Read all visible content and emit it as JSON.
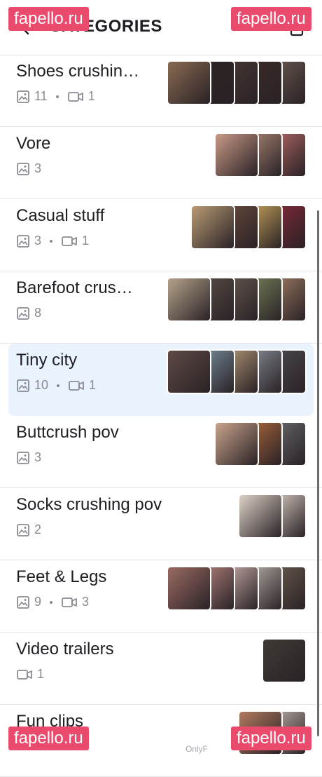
{
  "header": {
    "title": "CATEGORIES"
  },
  "rows": [
    {
      "title": "Shoes crushin…",
      "photos": "11",
      "videos": "1",
      "thumbs": [
        "#8a6a52",
        "#2e2424",
        "#4a3a36",
        "#3c2c28",
        "#6e5e52"
      ]
    },
    {
      "title": "Vore",
      "photos": "3",
      "videos": "",
      "thumbs": [
        "#c89a86",
        "#b68e7a",
        "#bd6e6a"
      ]
    },
    {
      "title": "Casual stuff",
      "photos": "3",
      "videos": "1",
      "thumbs": [
        "#b99b74",
        "#6e4e3e",
        "#d6b060",
        "#8e2a3a"
      ]
    },
    {
      "title": "Barefoot crus…",
      "photos": "8",
      "videos": "",
      "thumbs": [
        "#b4a28a",
        "#5c5248",
        "#6a5e52",
        "#7e8a5e",
        "#a8846a"
      ]
    },
    {
      "title": "Tiny city",
      "photos": "10",
      "videos": "1",
      "thumbs": [
        "#5e4a44",
        "#7e98a8",
        "#c0a27e",
        "#8e96a0",
        "#4e4e52"
      ]
    },
    {
      "title": "Buttcrush pov",
      "photos": "3",
      "videos": "",
      "thumbs": [
        "#c9a48c",
        "#b86e3e",
        "#6e7072"
      ]
    },
    {
      "title": "Socks crushing pov",
      "photos": "2",
      "videos": "",
      "thumbs": [
        "#dcd2c6",
        "#e8dcd0"
      ]
    },
    {
      "title": "Feet & Legs",
      "photos": "9",
      "videos": "3",
      "thumbs": [
        "#9a6a62",
        "#c08a86",
        "#d6b8b2",
        "#c4bcb4",
        "#6e6252"
      ]
    },
    {
      "title": "Video trailers",
      "photos": "",
      "videos": "1",
      "thumbs": [
        "#3e3a34"
      ]
    },
    {
      "title": "Fun clips",
      "photos": "",
      "videos": "",
      "thumbs": [
        "#b07a5e",
        "#c6b8b0"
      ]
    }
  ],
  "watermarks": [
    "fapello.ru",
    "fapello.ru",
    "fapello.ru",
    "fapello.ru"
  ],
  "footer_partial": "OnlyF"
}
